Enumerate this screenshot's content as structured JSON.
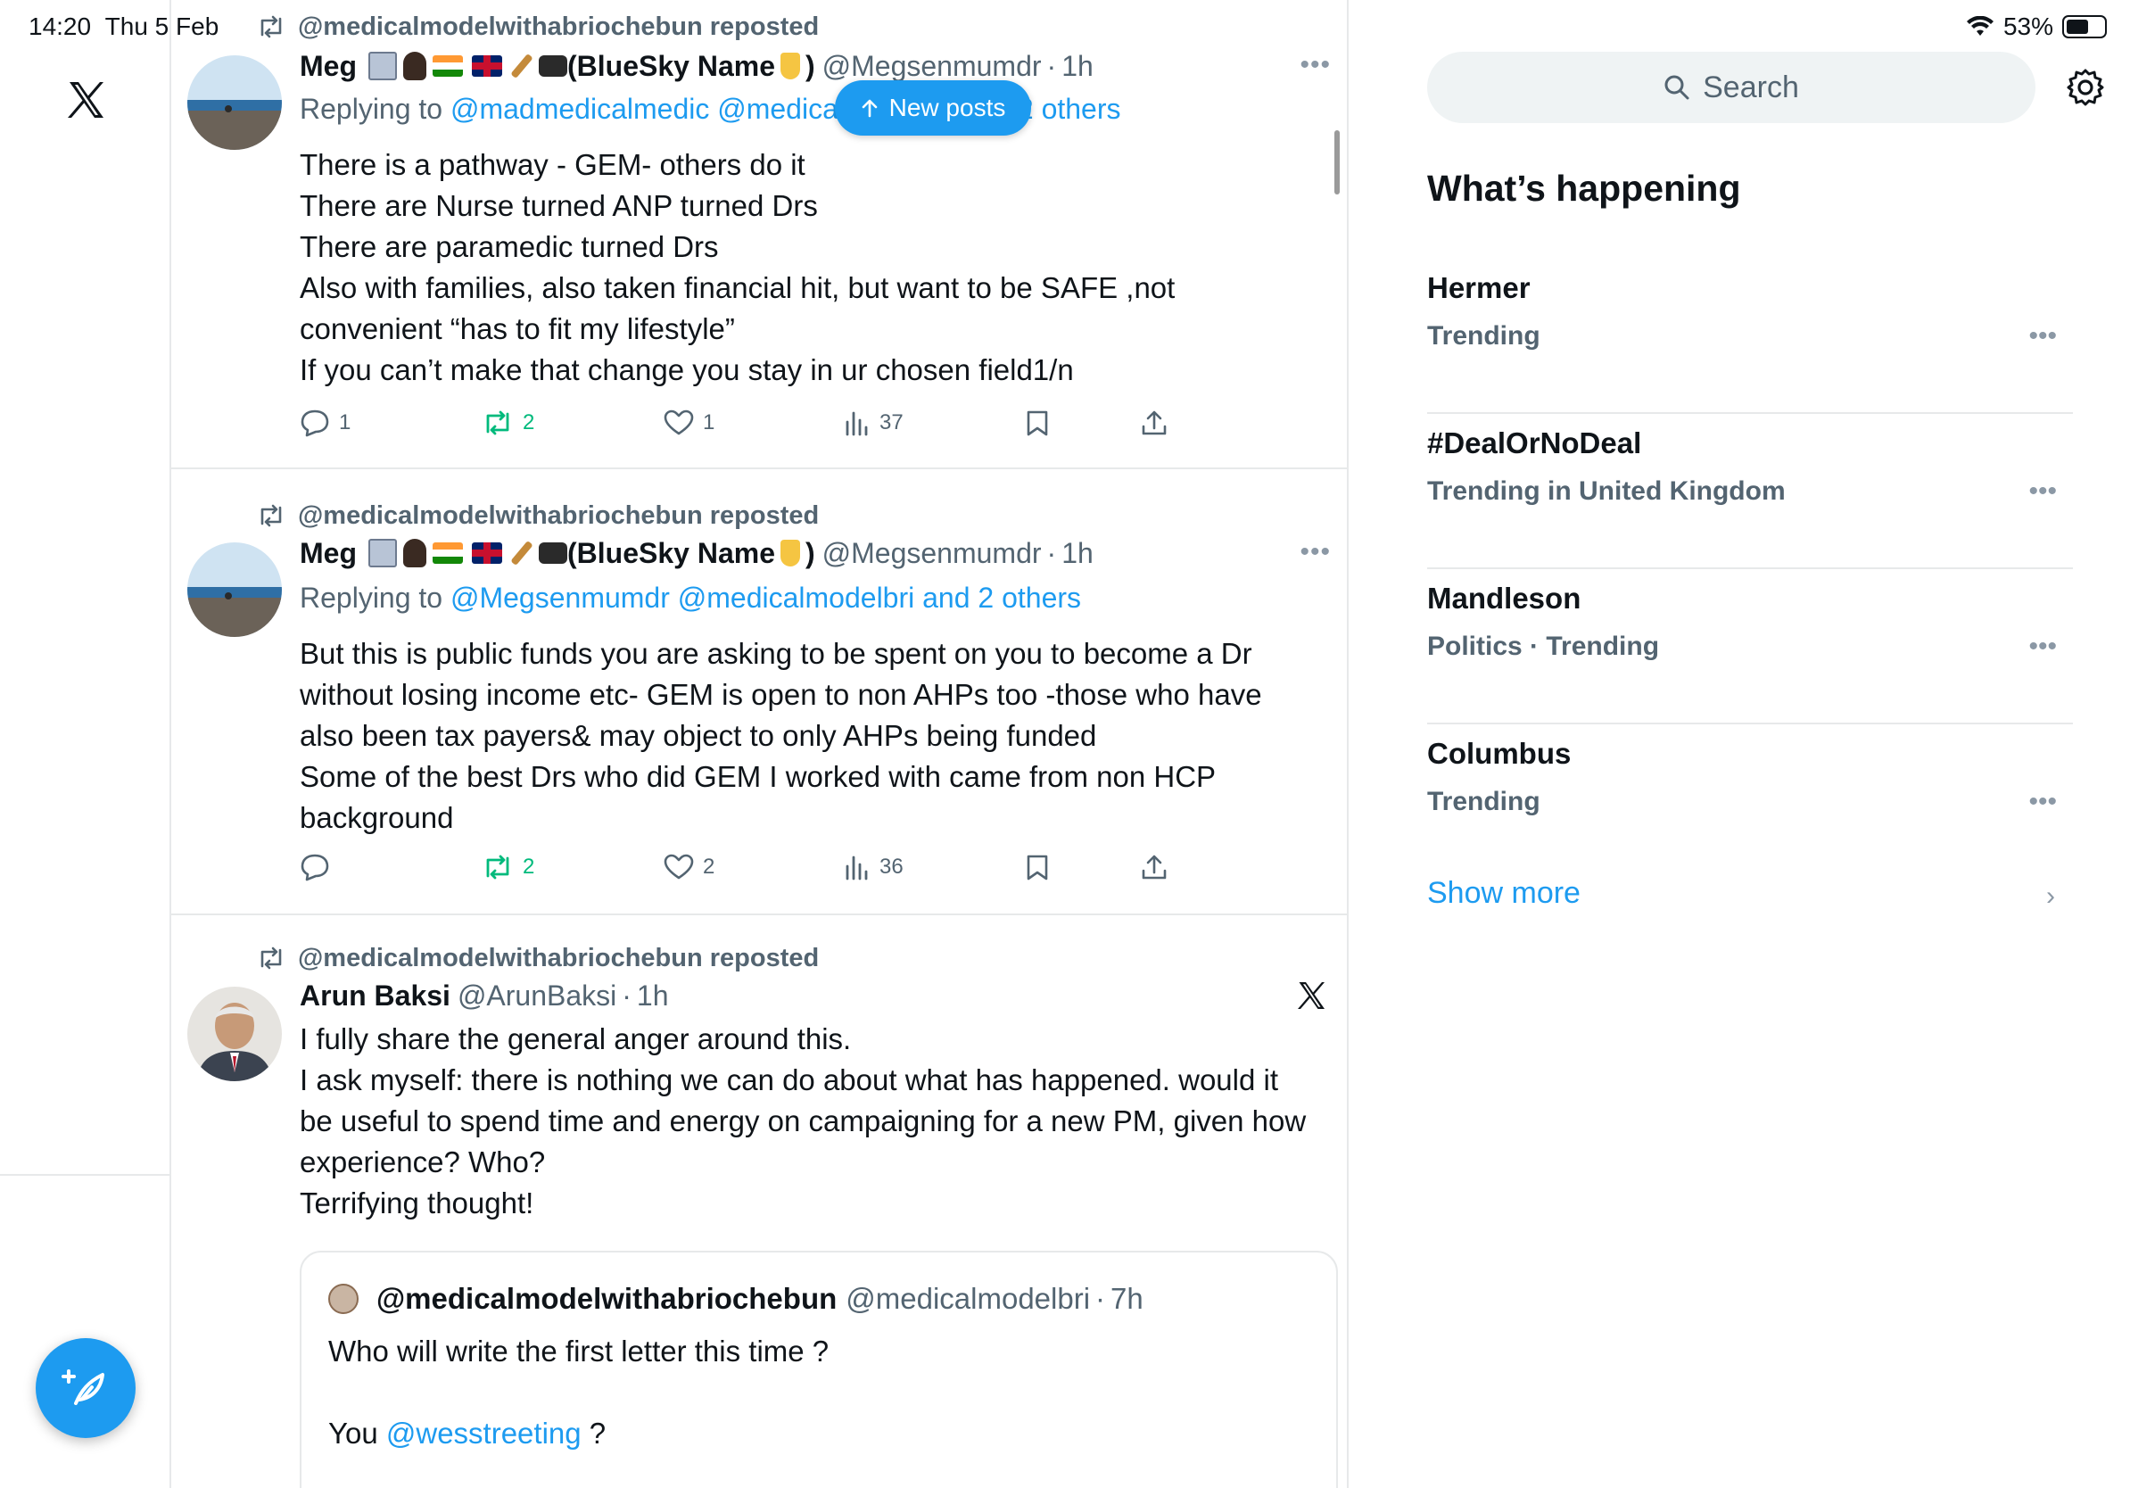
{
  "status": {
    "time": "14:20",
    "date": "Thu 5 Feb",
    "battery": "53%",
    "battery_level": 0.53,
    "wifi_icon": "wifi-icon"
  },
  "new_posts_label": "New posts",
  "tweets": [
    {
      "repost_label": "@medicalmodelwithabriochebun reposted",
      "name": "Meg",
      "name_suffix": "(BlueSky Name",
      "name_close": ")",
      "handle": "@Megsenmumdr",
      "time": "1h",
      "reply_prefix": "Replying to",
      "reply_users": "@madmedicalmedic @medicalmodelbri and 2 others",
      "body": [
        "There is a pathway - GEM- others do it",
        "There are Nurse turned ANP turned Drs",
        "There are paramedic turned Drs",
        "Also with families, also taken financial hit, but want to be SAFE ,not",
        "convenient “has to fit my lifestyle”",
        "If you can’t make that change you stay in ur chosen field1/n"
      ],
      "replies": "1",
      "reposts": "2",
      "likes": "1",
      "views": "37"
    },
    {
      "repost_label": "@medicalmodelwithabriochebun reposted",
      "name": "Meg",
      "name_suffix": "(BlueSky Name",
      "name_close": ")",
      "handle": "@Megsenmumdr",
      "time": "1h",
      "reply_prefix": "Replying to",
      "reply_users": "@Megsenmumdr @medicalmodelbri and 2 others",
      "body": [
        "But this is public funds you are asking to be spent on you to become a Dr",
        "without losing income etc- GEM is open to non AHPs too -those who have",
        "also been tax payers& may object to only AHPs being funded",
        "Some of the best Drs who did GEM I worked with came from non HCP",
        "background"
      ],
      "replies": "",
      "reposts": "2",
      "likes": "2",
      "views": "36"
    },
    {
      "repost_label": "@medicalmodelwithabriochebun reposted",
      "name": "Arun Baksi",
      "handle": "@ArunBaksi",
      "time": "1h",
      "body": [
        "I fully share the general anger around this.",
        "I ask myself: there is nothing we can do about what has happened. would it",
        "be useful to spend time and energy on campaigning for a new PM, given how",
        "experience? Who?",
        "Terrifying thought!"
      ],
      "quote": {
        "name": "@medicalmodelwithabriochebun",
        "handle": "@medicalmodelbri",
        "time": "7h",
        "line1": "Who will write the first letter this time ?",
        "line2_prefix": "You",
        "line2_link": "@wesstreeting",
        "line2_suffix": "?"
      }
    }
  ],
  "sidebar": {
    "search_placeholder": "Search",
    "heading": "What’s happening",
    "trends": [
      {
        "title": "Hermer",
        "meta": "Trending"
      },
      {
        "title": "#DealOrNoDeal",
        "meta": "Trending in United Kingdom"
      },
      {
        "title": "Mandleson",
        "meta": "Politics · Trending"
      },
      {
        "title": "Columbus",
        "meta": "Trending"
      }
    ],
    "show_more": "Show more"
  },
  "colors": {
    "accent": "#1d9bf0",
    "repost_green": "#00ba7c",
    "muted": "#536471"
  }
}
